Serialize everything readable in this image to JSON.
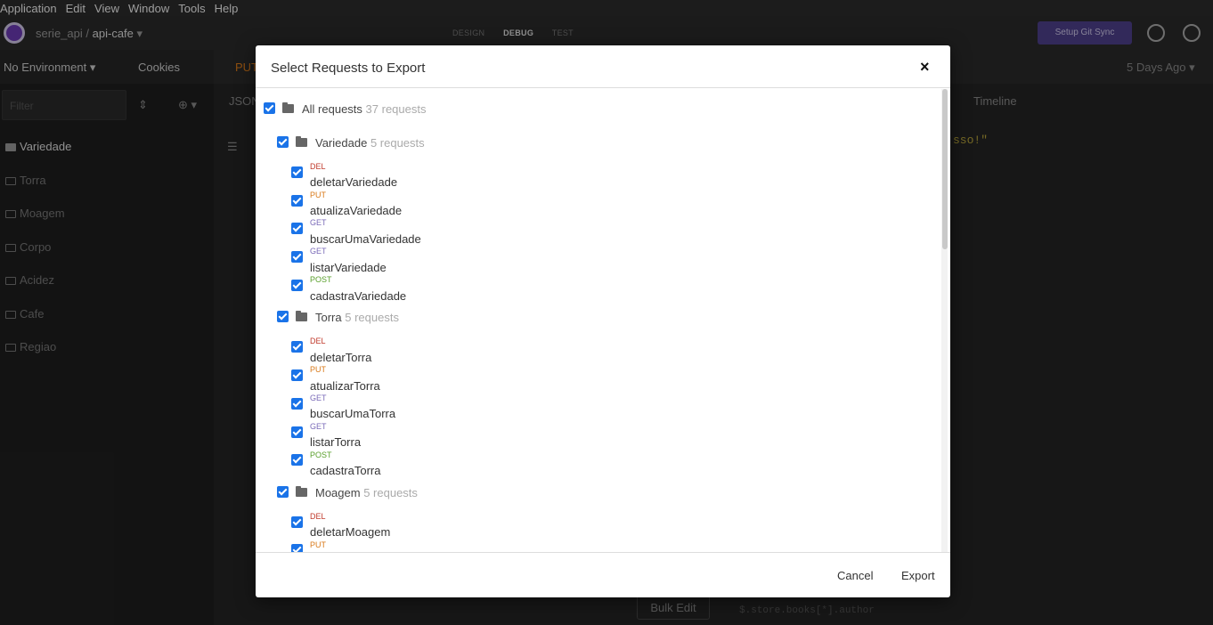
{
  "menu": [
    "Application",
    "Edit",
    "View",
    "Window",
    "Tools",
    "Help"
  ],
  "header": {
    "workspace": "serie_api",
    "separator": "/",
    "collection": "api-cafe",
    "modes": [
      "DESIGN",
      "DEBUG",
      "TEST"
    ],
    "git_sync": "Setup Git Sync"
  },
  "sidebar": {
    "environment": "No Environment",
    "cookies": "Cookies",
    "filter_placeholder": "Filter",
    "folders": [
      "Variedade",
      "Torra",
      "Moagem",
      "Corpo",
      "Acidez",
      "Cafe",
      "Regiao"
    ]
  },
  "background": {
    "method": "PUT",
    "tab": "JSON",
    "timeline": "Timeline",
    "time": "5 Days Ago",
    "snippet": "sso!\"",
    "bulk_edit": "Bulk Edit",
    "filter_hint": "$.store.books[*].author"
  },
  "modal": {
    "title": "Select Requests to Export",
    "close": "×",
    "all_label": "All requests",
    "all_count": "37 requests",
    "groups": [
      {
        "name": "Variedade",
        "count": "5 requests",
        "requests": [
          {
            "method": "DEL",
            "name": "deletarVariedade"
          },
          {
            "method": "PUT",
            "name": "atualizaVariedade"
          },
          {
            "method": "GET",
            "name": "buscarUmaVariedade"
          },
          {
            "method": "GET",
            "name": "listarVariedade"
          },
          {
            "method": "POST",
            "name": "cadastraVariedade"
          }
        ]
      },
      {
        "name": "Torra",
        "count": "5 requests",
        "requests": [
          {
            "method": "DEL",
            "name": "deletarTorra"
          },
          {
            "method": "PUT",
            "name": "atualizarTorra"
          },
          {
            "method": "GET",
            "name": "buscarUmaTorra"
          },
          {
            "method": "GET",
            "name": "listarTorra"
          },
          {
            "method": "POST",
            "name": "cadastraTorra"
          }
        ]
      },
      {
        "name": "Moagem",
        "count": "5 requests",
        "requests": [
          {
            "method": "DEL",
            "name": "deletarMoagem"
          },
          {
            "method": "PUT",
            "name": ""
          }
        ]
      }
    ],
    "cancel": "Cancel",
    "export": "Export"
  }
}
